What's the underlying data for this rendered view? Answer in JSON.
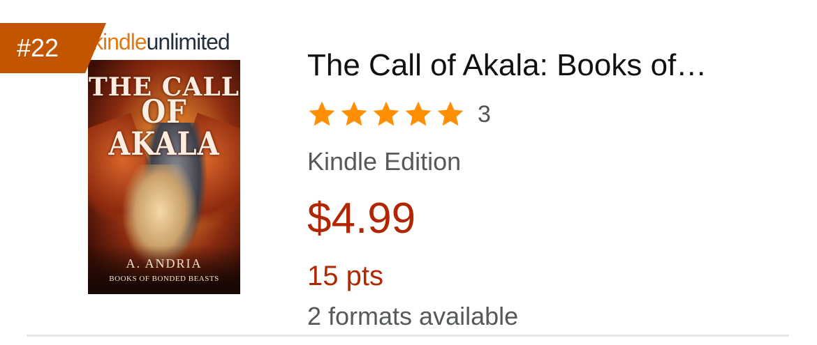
{
  "badge": {
    "rank": "#22"
  },
  "program_logo": {
    "part1": "kindle",
    "part2": "unlimited"
  },
  "cover": {
    "title_line1": "THE CALL",
    "title_line2": "OF AKALA",
    "author": "A. ANDRIA",
    "series": "BOOKS OF BONDED BEASTS"
  },
  "product": {
    "title": "The Call of Akala: Books of…",
    "rating": {
      "stars": 5,
      "count": "3",
      "star_icon": "star-icon",
      "star_color": "#ff8f00"
    },
    "format": "Kindle Edition",
    "price": "$4.99",
    "points": "15 pts",
    "formats_available": "2 formats available"
  },
  "colors": {
    "price": "#b12704",
    "badge": "#c45500",
    "kindle": "#e47911",
    "secondary_text": "#565959"
  }
}
